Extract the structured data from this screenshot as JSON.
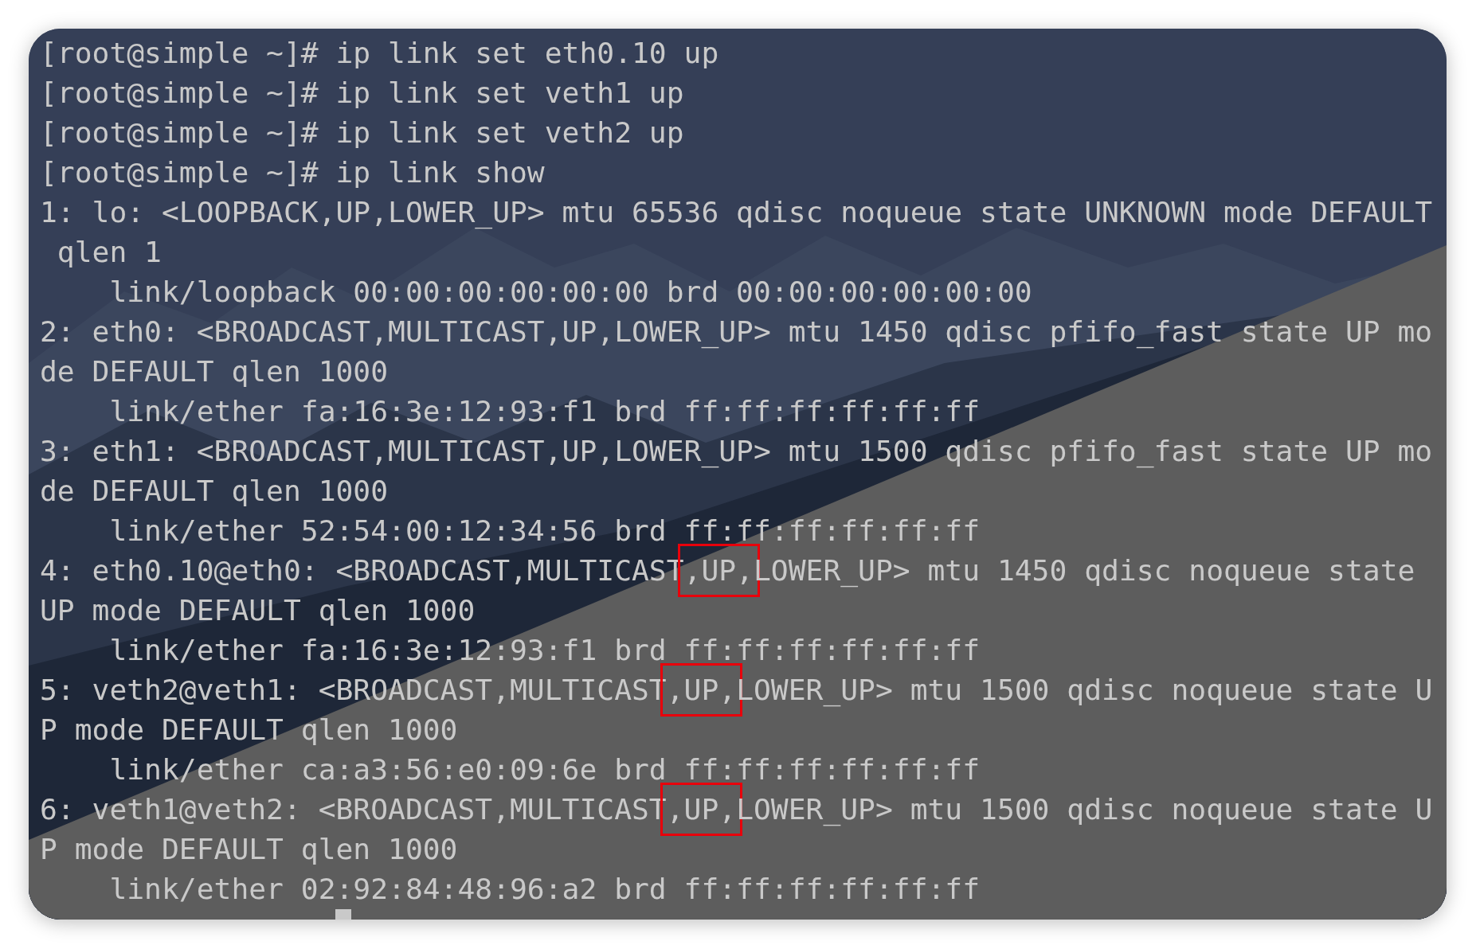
{
  "terminal": {
    "lines": [
      {
        "segments": [
          {
            "text": "[root@simple ~]# ip link set eth0.10 up",
            "boxed": false
          }
        ]
      },
      {
        "segments": [
          {
            "text": "[root@simple ~]# ip link set veth1 up",
            "boxed": false
          }
        ]
      },
      {
        "segments": [
          {
            "text": "[root@simple ~]# ip link set veth2 up",
            "boxed": false
          }
        ]
      },
      {
        "segments": [
          {
            "text": "[root@simple ~]# ip link show",
            "boxed": false
          }
        ]
      },
      {
        "segments": [
          {
            "text": "1: lo: <LOOPBACK,UP,LOWER_UP> mtu 65536 qdisc noqueue state UNKNOWN mode DEFAULT",
            "boxed": false
          }
        ]
      },
      {
        "segments": [
          {
            "text": " qlen 1",
            "boxed": false
          }
        ]
      },
      {
        "segments": [
          {
            "text": "    link/loopback 00:00:00:00:00:00 brd 00:00:00:00:00:00",
            "boxed": false
          }
        ]
      },
      {
        "segments": [
          {
            "text": "2: eth0: <BROADCAST,MULTICAST,UP,LOWER_UP> mtu 1450 qdisc pfifo_fast state UP mo",
            "boxed": false
          }
        ]
      },
      {
        "segments": [
          {
            "text": "de DEFAULT qlen 1000",
            "boxed": false
          }
        ]
      },
      {
        "segments": [
          {
            "text": "    link/ether fa:16:3e:12:93:f1 brd ff:ff:ff:ff:ff:ff",
            "boxed": false
          }
        ]
      },
      {
        "segments": [
          {
            "text": "3: eth1: <BROADCAST,MULTICAST,UP,LOWER_UP> mtu 1500 qdisc pfifo_fast state UP mo",
            "boxed": false
          }
        ]
      },
      {
        "segments": [
          {
            "text": "de DEFAULT qlen 1000",
            "boxed": false
          }
        ]
      },
      {
        "segments": [
          {
            "text": "    link/ether 52:54:00:12:34:56 brd ff:ff:ff:ff:ff:ff",
            "boxed": false
          }
        ]
      },
      {
        "segments": [
          {
            "text": "4: eth0.10@eth0: <BROADCAST,MULTICAST",
            "boxed": false
          },
          {
            "text": ",UP,",
            "boxed": true
          },
          {
            "text": "LOWER_UP> mtu 1450 qdisc noqueue state",
            "boxed": false
          }
        ]
      },
      {
        "segments": [
          {
            "text": "UP mode DEFAULT qlen 1000",
            "boxed": false
          }
        ]
      },
      {
        "segments": [
          {
            "text": "    link/ether fa:16:3e:12:93:f1 brd ff:ff:ff:ff:ff:ff",
            "boxed": false
          }
        ]
      },
      {
        "segments": [
          {
            "text": "5: veth2@veth1: <BROADCAST,MULTICAST",
            "boxed": false
          },
          {
            "text": ",UP,",
            "boxed": true
          },
          {
            "text": "LOWER_UP> mtu 1500 qdisc noqueue state U",
            "boxed": false
          }
        ]
      },
      {
        "segments": [
          {
            "text": "P mode DEFAULT qlen 1000",
            "boxed": false
          }
        ]
      },
      {
        "segments": [
          {
            "text": "    link/ether ca:a3:56:e0:09:6e brd ff:ff:ff:ff:ff:ff",
            "boxed": false
          }
        ]
      },
      {
        "segments": [
          {
            "text": "6: veth1@veth2: <BROADCAST,MULTICAST",
            "boxed": false
          },
          {
            "text": ",UP,",
            "boxed": true
          },
          {
            "text": "LOWER_UP> mtu 1500 qdisc noqueue state U",
            "boxed": false
          }
        ]
      },
      {
        "segments": [
          {
            "text": "P mode DEFAULT qlen 1000",
            "boxed": false
          }
        ]
      },
      {
        "segments": [
          {
            "text": "    link/ether 02:92:84:48:96:a2 brd ff:ff:ff:ff:ff:ff",
            "boxed": false
          }
        ]
      }
    ]
  }
}
